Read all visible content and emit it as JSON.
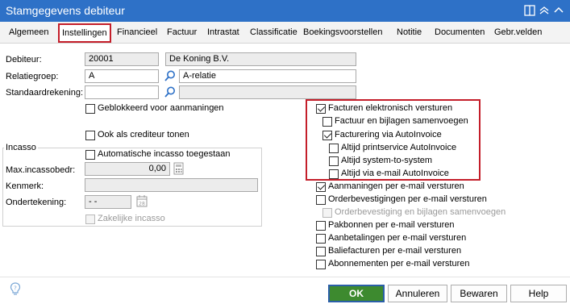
{
  "window": {
    "title": "Stamgegevens debiteur"
  },
  "tabs": [
    "Algemeen",
    "Instellingen",
    "Financieel",
    "Factuur",
    "Intrastat",
    "Classificatie",
    "Boekingsvoorstellen",
    "Notitie",
    "Documenten",
    "Gebr.velden"
  ],
  "active_tab": "Instellingen",
  "form": {
    "debiteur_label": "Debiteur:",
    "debiteur_code": "20001",
    "debiteur_name": "De Koning B.V.",
    "relatiegroep_label": "Relatiegroep:",
    "relatiegroep_code": "A",
    "relatiegroep_name": "A-relatie",
    "standaardrekening_label": "Standaardrekening:",
    "standaardrekening_code": "",
    "standaardrekening_name": ""
  },
  "left_checks": {
    "geblokkeerd": {
      "label": "Geblokkeerd voor aanmaningen",
      "checked": false
    },
    "crediteur": {
      "label": "Ook als crediteur tonen",
      "checked": false
    }
  },
  "incasso": {
    "group_label": "Incasso",
    "automatisch": {
      "label": "Automatische incasso toegestaan",
      "checked": false
    },
    "max_label": "Max.incassobedr:",
    "max_value": "0,00",
    "kenmerk_label": "Kenmerk:",
    "kenmerk_value": "",
    "ondertekening_label": "Ondertekening:",
    "ondertekening_value": "- -",
    "zakelijk": {
      "label": "Zakelijke incasso",
      "checked": false,
      "disabled": true
    }
  },
  "right_checks": [
    {
      "label": "Facturen elektronisch versturen",
      "checked": true,
      "disabled": false
    },
    {
      "label": "Factuur en bijlagen samenvoegen",
      "checked": false,
      "disabled": false
    },
    {
      "label": "Facturering via AutoInvoice",
      "checked": true,
      "disabled": false
    },
    {
      "label": "Altijd printservice AutoInvoice",
      "checked": false,
      "disabled": false
    },
    {
      "label": "Altijd system-to-system",
      "checked": false,
      "disabled": false
    },
    {
      "label": "Altijd via e-mail AutoInvoice",
      "checked": false,
      "disabled": false
    },
    {
      "label": "Aanmaningen per e-mail versturen",
      "checked": true,
      "disabled": false
    },
    {
      "label": "Orderbevestigingen per e-mail versturen",
      "checked": false,
      "disabled": false
    },
    {
      "label": "Orderbevestiging en bijlagen samenvoegen",
      "checked": false,
      "disabled": true
    },
    {
      "label": "Pakbonnen per e-mail versturen",
      "checked": false,
      "disabled": false
    },
    {
      "label": "Aanbetalingen per e-mail versturen",
      "checked": false,
      "disabled": false
    },
    {
      "label": "Baliefacturen per e-mail versturen",
      "checked": false,
      "disabled": false
    },
    {
      "label": "Abonnementen per e-mail versturen",
      "checked": false,
      "disabled": false
    }
  ],
  "buttons": {
    "ok": "OK",
    "annuleren": "Annuleren",
    "bewaren": "Bewaren",
    "help": "Help"
  },
  "icons": [
    "columns-icon",
    "collapse-up-icon",
    "chevron-up-icon",
    "search-icon",
    "calculator-icon",
    "calendar-icon",
    "help-lightbulb-icon"
  ],
  "colors": {
    "titlebar": "#2e71c7",
    "highlight": "#c41e2a",
    "ok_button": "#3d8a2f"
  }
}
